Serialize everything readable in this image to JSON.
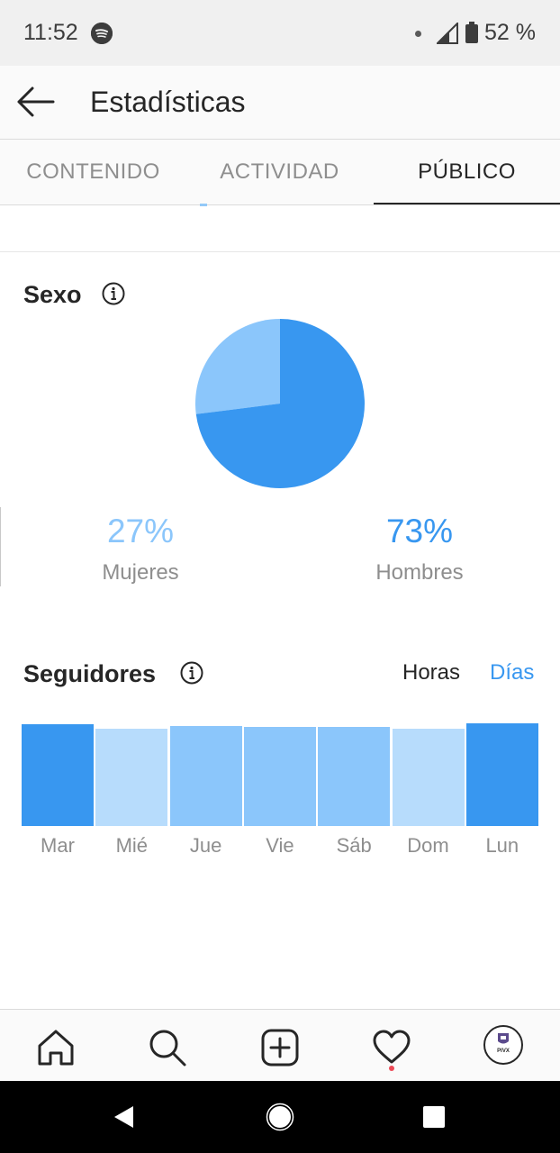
{
  "status_bar": {
    "time": "11:52",
    "battery": "52 %"
  },
  "header": {
    "title": "Estadísticas"
  },
  "tabs": [
    {
      "label": "CONTENIDO",
      "active": false
    },
    {
      "label": "ACTIVIDAD",
      "active": false
    },
    {
      "label": "PÚBLICO",
      "active": true
    }
  ],
  "gender": {
    "title": "Sexo",
    "women": {
      "percent": "27%",
      "label": "Mujeres"
    },
    "men": {
      "percent": "73%",
      "label": "Hombres"
    }
  },
  "followers": {
    "title": "Seguidores",
    "toggle_hours": "Horas",
    "toggle_days": "Días"
  },
  "colors": {
    "accent": "#3897f0",
    "light_blue": "#8bc6fb",
    "lighter_blue": "#b7dcfc",
    "text": "#262626",
    "muted": "#8e8e8e"
  },
  "chart_data": [
    {
      "type": "pie",
      "title": "Sexo",
      "categories": [
        "Mujeres",
        "Hombres"
      ],
      "values": [
        27,
        73
      ],
      "colors": [
        "#8bc6fb",
        "#3897f0"
      ]
    },
    {
      "type": "bar",
      "title": "Seguidores",
      "categories": [
        "Mar",
        "Mié",
        "Jue",
        "Vie",
        "Sáb",
        "Dom",
        "Lun"
      ],
      "values": [
        113,
        108,
        111,
        110,
        110,
        108,
        114
      ],
      "ylim": [
        0,
        114
      ],
      "colors": [
        "#3897f0",
        "#b7dcfc",
        "#8bc6fb",
        "#8bc6fb",
        "#8bc6fb",
        "#b7dcfc",
        "#3897f0"
      ]
    }
  ]
}
